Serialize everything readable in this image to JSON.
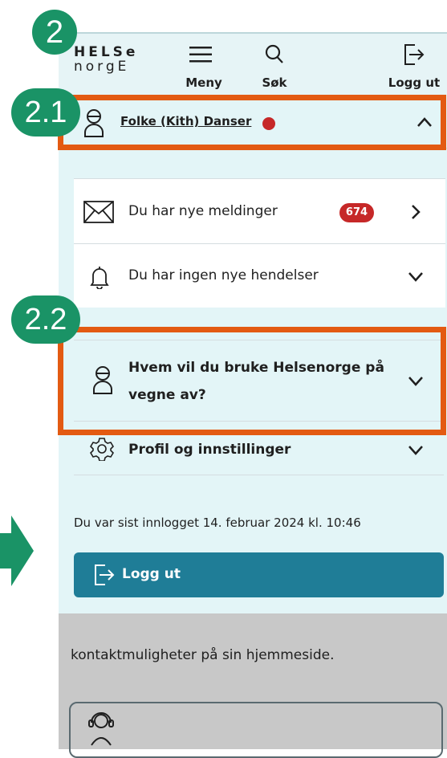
{
  "header": {
    "logo_line1": "HELSe",
    "logo_line2": "norgE",
    "menu_label": "Meny",
    "search_label": "Søk",
    "logout_label": "Logg ut"
  },
  "user": {
    "name": "Folke (Kith) Danser"
  },
  "notifications": {
    "messages_label": "Du har nye meldinger",
    "messages_count": "674",
    "events_label": "Du har ingen nye hendelser"
  },
  "represent": {
    "label_line1": "Hvem vil du bruke Helsenorge på",
    "label_line2": "vegne av?"
  },
  "profile": {
    "label": "Profil og innstillinger"
  },
  "last_login": "Du var sist innlogget 14. februar 2024 kl. 10:46",
  "logout_button": "Logg ut",
  "background_text": "kontaktmuligheter på sin hjemmeside.",
  "annotations": {
    "n2": "2",
    "n21": "2.1",
    "n22": "2.2"
  },
  "colors": {
    "accent_orange": "#e35a12",
    "annotation_green": "#1a9366",
    "button_teal": "#1f7d97",
    "badge_red": "#c62828"
  }
}
